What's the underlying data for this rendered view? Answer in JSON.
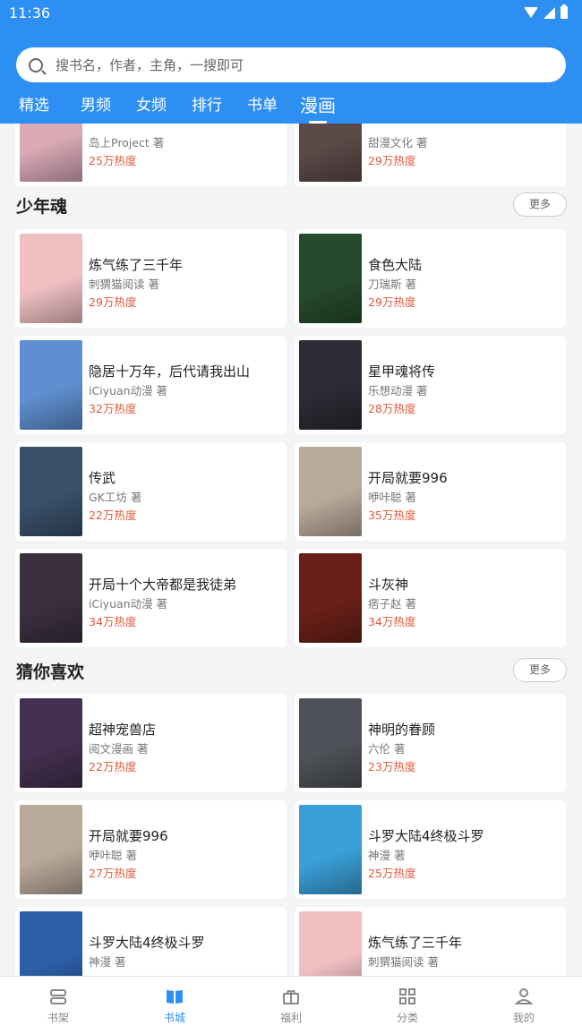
{
  "status_bar": {
    "time": "11:36"
  },
  "search": {
    "placeholder": "搜书名，作者，主角，一搜即可"
  },
  "tabs": [
    {
      "label": "精选"
    },
    {
      "label": "男频"
    },
    {
      "label": "女频"
    },
    {
      "label": "排行"
    },
    {
      "label": "书单"
    },
    {
      "label": "漫画"
    }
  ],
  "active_tab": "漫画",
  "partial_row": [
    {
      "author": "岛上Project 著",
      "heat": "25万热度",
      "cover_color": "#d9a9b6"
    },
    {
      "author": "甜漫文化 著",
      "heat": "29万热度",
      "cover_color": "#5c4a48"
    }
  ],
  "sections": [
    {
      "title": "少年魂",
      "more": "更多",
      "books": [
        {
          "title": "炼气练了三千年",
          "author": "刺猬猫阅读 著",
          "heat": "29万热度",
          "cover_color": "#efbfc2"
        },
        {
          "title": "食色大陆",
          "author": "刀瑞斯 著",
          "heat": "29万热度",
          "cover_color": "#274a2c"
        },
        {
          "title": "隐居十万年，后代请我出山",
          "author": "iCiyuan动漫 著",
          "heat": "32万热度",
          "cover_color": "#5f8fd0"
        },
        {
          "title": "星甲魂将传",
          "author": "乐想动漫 著",
          "heat": "28万热度",
          "cover_color": "#2c2a33"
        },
        {
          "title": "传武",
          "author": "GK工坊 著",
          "heat": "22万热度",
          "cover_color": "#39506a"
        },
        {
          "title": "开局就要996",
          "author": "咿咔聪 著",
          "heat": "35万热度",
          "cover_color": "#b9a99a"
        },
        {
          "title": "开局十个大帝都是我徒弟",
          "author": "iCiyuan动漫 著",
          "heat": "34万热度",
          "cover_color": "#3b2f3f"
        },
        {
          "title": "斗灰神",
          "author": "痞子赵 著",
          "heat": "34万热度",
          "cover_color": "#6a2018"
        }
      ]
    },
    {
      "title": "猜你喜欢",
      "more": "更多",
      "books": [
        {
          "title": "超神宠兽店",
          "author": "阅文漫画 著",
          "heat": "22万热度",
          "cover_color": "#432f4f"
        },
        {
          "title": "神明的眷顾",
          "author": "六伦 著",
          "heat": "23万热度",
          "cover_color": "#4e5258"
        },
        {
          "title": "开局就要996",
          "author": "咿咔聪 著",
          "heat": "27万热度",
          "cover_color": "#b9a99a"
        },
        {
          "title": "斗罗大陆4终极斗罗",
          "author": "神漫 著",
          "heat": "25万热度",
          "cover_color": "#3aa0d8"
        },
        {
          "title": "斗罗大陆4终极斗罗",
          "author": "神漫 著",
          "heat": "",
          "cover_color": "#2c5fa8"
        },
        {
          "title": "炼气练了三千年",
          "author": "刺猬猫阅读 著",
          "heat": "",
          "cover_color": "#efbfc2"
        }
      ]
    }
  ],
  "bottom_nav": [
    {
      "label": "书架",
      "icon": "bookshelf-icon"
    },
    {
      "label": "书城",
      "icon": "book-open-icon"
    },
    {
      "label": "福利",
      "icon": "gift-icon"
    },
    {
      "label": "分类",
      "icon": "grid-icon"
    },
    {
      "label": "我的",
      "icon": "user-icon"
    }
  ],
  "active_nav": "书城",
  "colors": {
    "primary": "#2e8ff3",
    "heat": "#e15a3b",
    "background": "#f3f4f6"
  }
}
